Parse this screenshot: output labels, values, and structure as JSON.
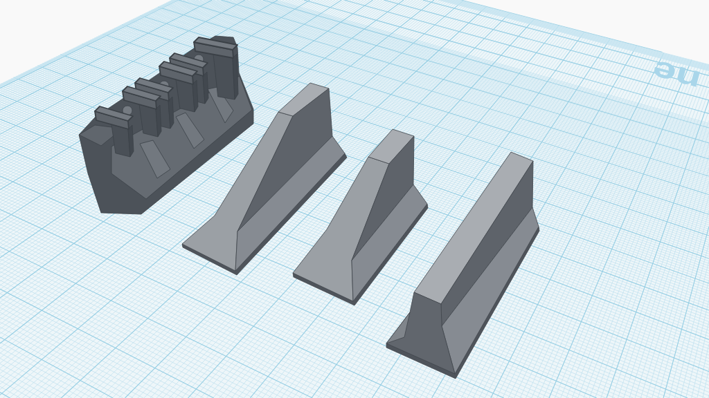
{
  "workplane": {
    "label": "ne"
  }
}
